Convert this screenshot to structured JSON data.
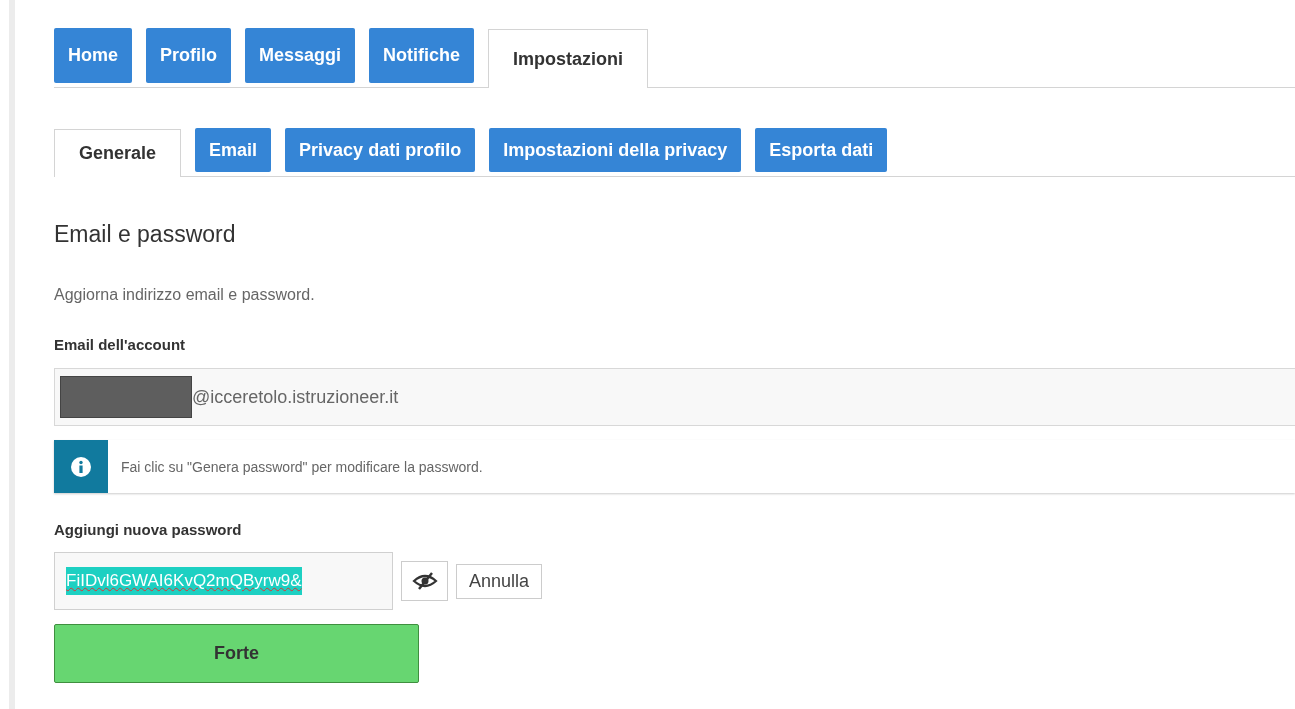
{
  "tabs": [
    {
      "label": "Home",
      "selected": false
    },
    {
      "label": "Profilo",
      "selected": false
    },
    {
      "label": "Messaggi",
      "selected": false
    },
    {
      "label": "Notifiche",
      "selected": false
    },
    {
      "label": "Impostazioni",
      "selected": true
    }
  ],
  "subtabs": [
    {
      "label": "Generale",
      "selected": true
    },
    {
      "label": "Email",
      "selected": false
    },
    {
      "label": "Privacy dati profilo",
      "selected": false
    },
    {
      "label": "Impostazioni della privacy",
      "selected": false
    },
    {
      "label": "Esporta dati",
      "selected": false
    }
  ],
  "section": {
    "title": "Email e password",
    "description": "Aggiorna indirizzo email e password."
  },
  "email": {
    "label": "Email dell'account",
    "redacted": true,
    "value": "@icceretolo.istruzioneer.it"
  },
  "info": {
    "text": "Fai clic su \"Genera password\" per modificare la password."
  },
  "password": {
    "label": "Aggiungi nuova password",
    "value": "FiIDvl6GWAI6KvQ2mQByrw9&",
    "text_selected": true,
    "cancel": "Annulla"
  },
  "strength": {
    "label": "Forte"
  }
}
